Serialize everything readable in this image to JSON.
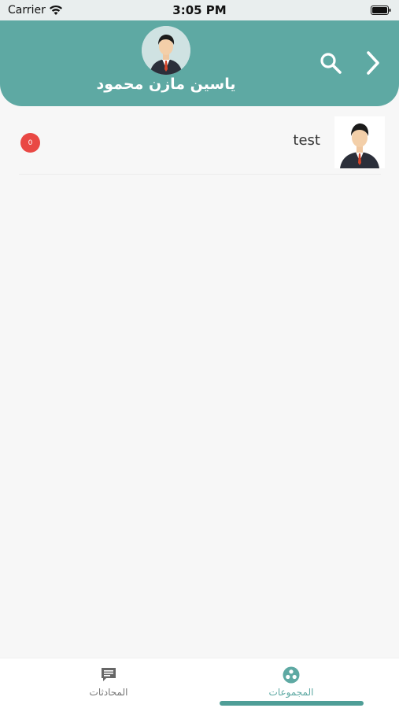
{
  "status_bar": {
    "carrier": "Carrier",
    "time": "3:05 PM",
    "wifi_icon": "wifi-icon",
    "battery_icon": "battery-icon"
  },
  "header": {
    "profile_name": "ياسين مازن محمود",
    "search_icon": "search-icon",
    "back_icon": "chevron-right-icon",
    "accent_color": "#5ea9a3"
  },
  "groups": [
    {
      "title": "test",
      "unread": "0"
    }
  ],
  "tabbar": {
    "tabs": [
      {
        "label": "المحادثات",
        "icon": "chat-icon"
      },
      {
        "label": "المجموعات",
        "icon": "groups-icon",
        "active": true
      }
    ]
  },
  "colors": {
    "badge": "#e94844",
    "accent": "#5ea9a3",
    "indicator": "#4f9e97"
  }
}
